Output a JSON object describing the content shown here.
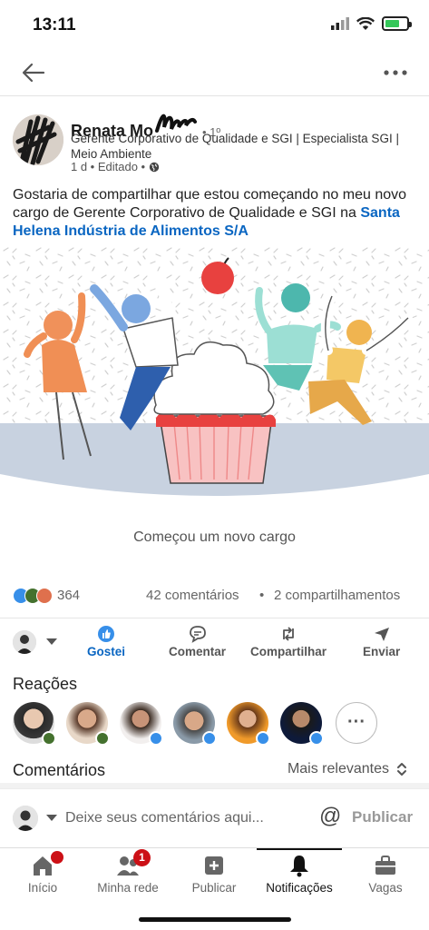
{
  "status_bar": {
    "time": "13:11"
  },
  "post": {
    "author_name": "Renata Mo",
    "degree": "• 1º",
    "headline": "Gerente Corporativo de Qualidade e SGI | Especialista SGI | Meio Ambiente",
    "meta": "1 d • Editado •",
    "text": "Gostaria de compartilhar que estou começando no meu novo cargo de Gerente Corporativo de Qualidade e SGI na",
    "company_link": "Santa Helena Indústria de Alimentos S/A",
    "caption": "Começou um novo cargo"
  },
  "social": {
    "reactions_count": "364",
    "comments": "42 comentários",
    "separator": "•",
    "shares": "2 compartilhamentos"
  },
  "actions": {
    "like": "Gostei",
    "comment": "Comentar",
    "share": "Compartilhar",
    "send": "Enviar"
  },
  "reactions_section": {
    "title": "Reações",
    "more": "···"
  },
  "comments_section": {
    "title": "Comentários",
    "sort_label": "Mais relevantes"
  },
  "comment_bar": {
    "placeholder": "Deixe seus comentários aqui...",
    "mention": "@",
    "publish": "Publicar"
  },
  "tabs": [
    {
      "label": "Início",
      "badge": ""
    },
    {
      "label": "Minha rede",
      "badge": "1"
    },
    {
      "label": "Publicar",
      "badge": ""
    },
    {
      "label": "Notificações",
      "badge": ""
    },
    {
      "label": "Vagas",
      "badge": ""
    }
  ],
  "colors": {
    "link_blue": "#0a66c2",
    "like_blue": "#378fe9",
    "badge_red": "#cc1016",
    "celebrate_green": "#44712e",
    "love_red": "#df704d"
  },
  "icons": {
    "back": "arrow-left-icon",
    "more": "ellipsis-icon",
    "globe": "globe-icon",
    "like": "thumbs-up-icon",
    "comment": "speech-bubble-icon",
    "share": "repost-icon",
    "send": "paper-plane-icon",
    "sort": "chevron-up-down-icon",
    "home": "house-icon",
    "network": "people-icon",
    "post": "plus-square-icon",
    "notifications": "bell-icon",
    "jobs": "briefcase-icon"
  }
}
